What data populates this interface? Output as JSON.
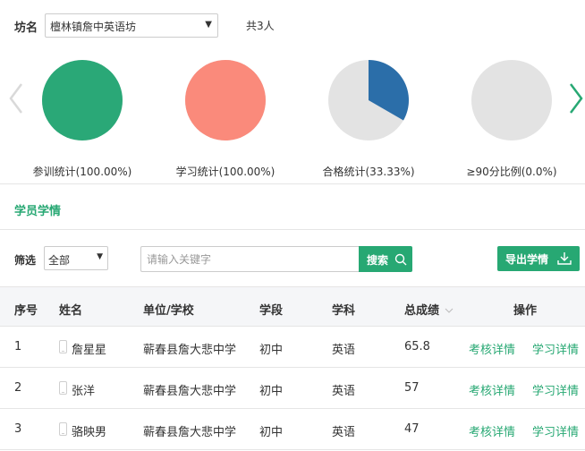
{
  "filter_top": {
    "label": "坊名",
    "selected": "檀林镇詹中英语坊",
    "total": "共3人"
  },
  "colors": {
    "accent": "#27a873",
    "pie_green": "#2aa877",
    "pie_salmon": "#fa8a7b",
    "pie_blue": "#2b6ea9",
    "pie_empty": "#e3e3e3"
  },
  "chart_data": [
    {
      "type": "pie",
      "label": "参训统计(100.00%)",
      "value": 100.0,
      "color": "#2aa877"
    },
    {
      "type": "pie",
      "label": "学习统计(100.00%)",
      "value": 100.0,
      "color": "#fa8a7b"
    },
    {
      "type": "pie",
      "label": "合格统计(33.33%)",
      "value": 33.33,
      "color": "#2b6ea9"
    },
    {
      "type": "pie",
      "label": "≥90分比例(0.0%)",
      "value": 0.0,
      "color": "#2b6ea9"
    }
  ],
  "section_title": "学员学情",
  "toolbar": {
    "filter_label": "筛选",
    "filter_value": "全部",
    "search_placeholder": "请输入关键字",
    "search_label": "搜索",
    "export_label": "导出学情"
  },
  "table": {
    "headers": [
      "序号",
      "姓名",
      "单位/学校",
      "学段",
      "学科",
      "总成绩",
      "操作"
    ],
    "rows": [
      {
        "no": "1",
        "name": "詹星星",
        "school": "蕲春县詹大悲中学",
        "stage": "初中",
        "subject": "英语",
        "score": "65.8",
        "action1": "考核详情",
        "action2": "学习详情"
      },
      {
        "no": "2",
        "name": "张洋",
        "school": "蕲春县詹大悲中学",
        "stage": "初中",
        "subject": "英语",
        "score": "57",
        "action1": "考核详情",
        "action2": "学习详情"
      },
      {
        "no": "3",
        "name": "骆映男",
        "school": "蕲春县詹大悲中学",
        "stage": "初中",
        "subject": "英语",
        "score": "47",
        "action1": "考核详情",
        "action2": "学习详情"
      }
    ]
  }
}
